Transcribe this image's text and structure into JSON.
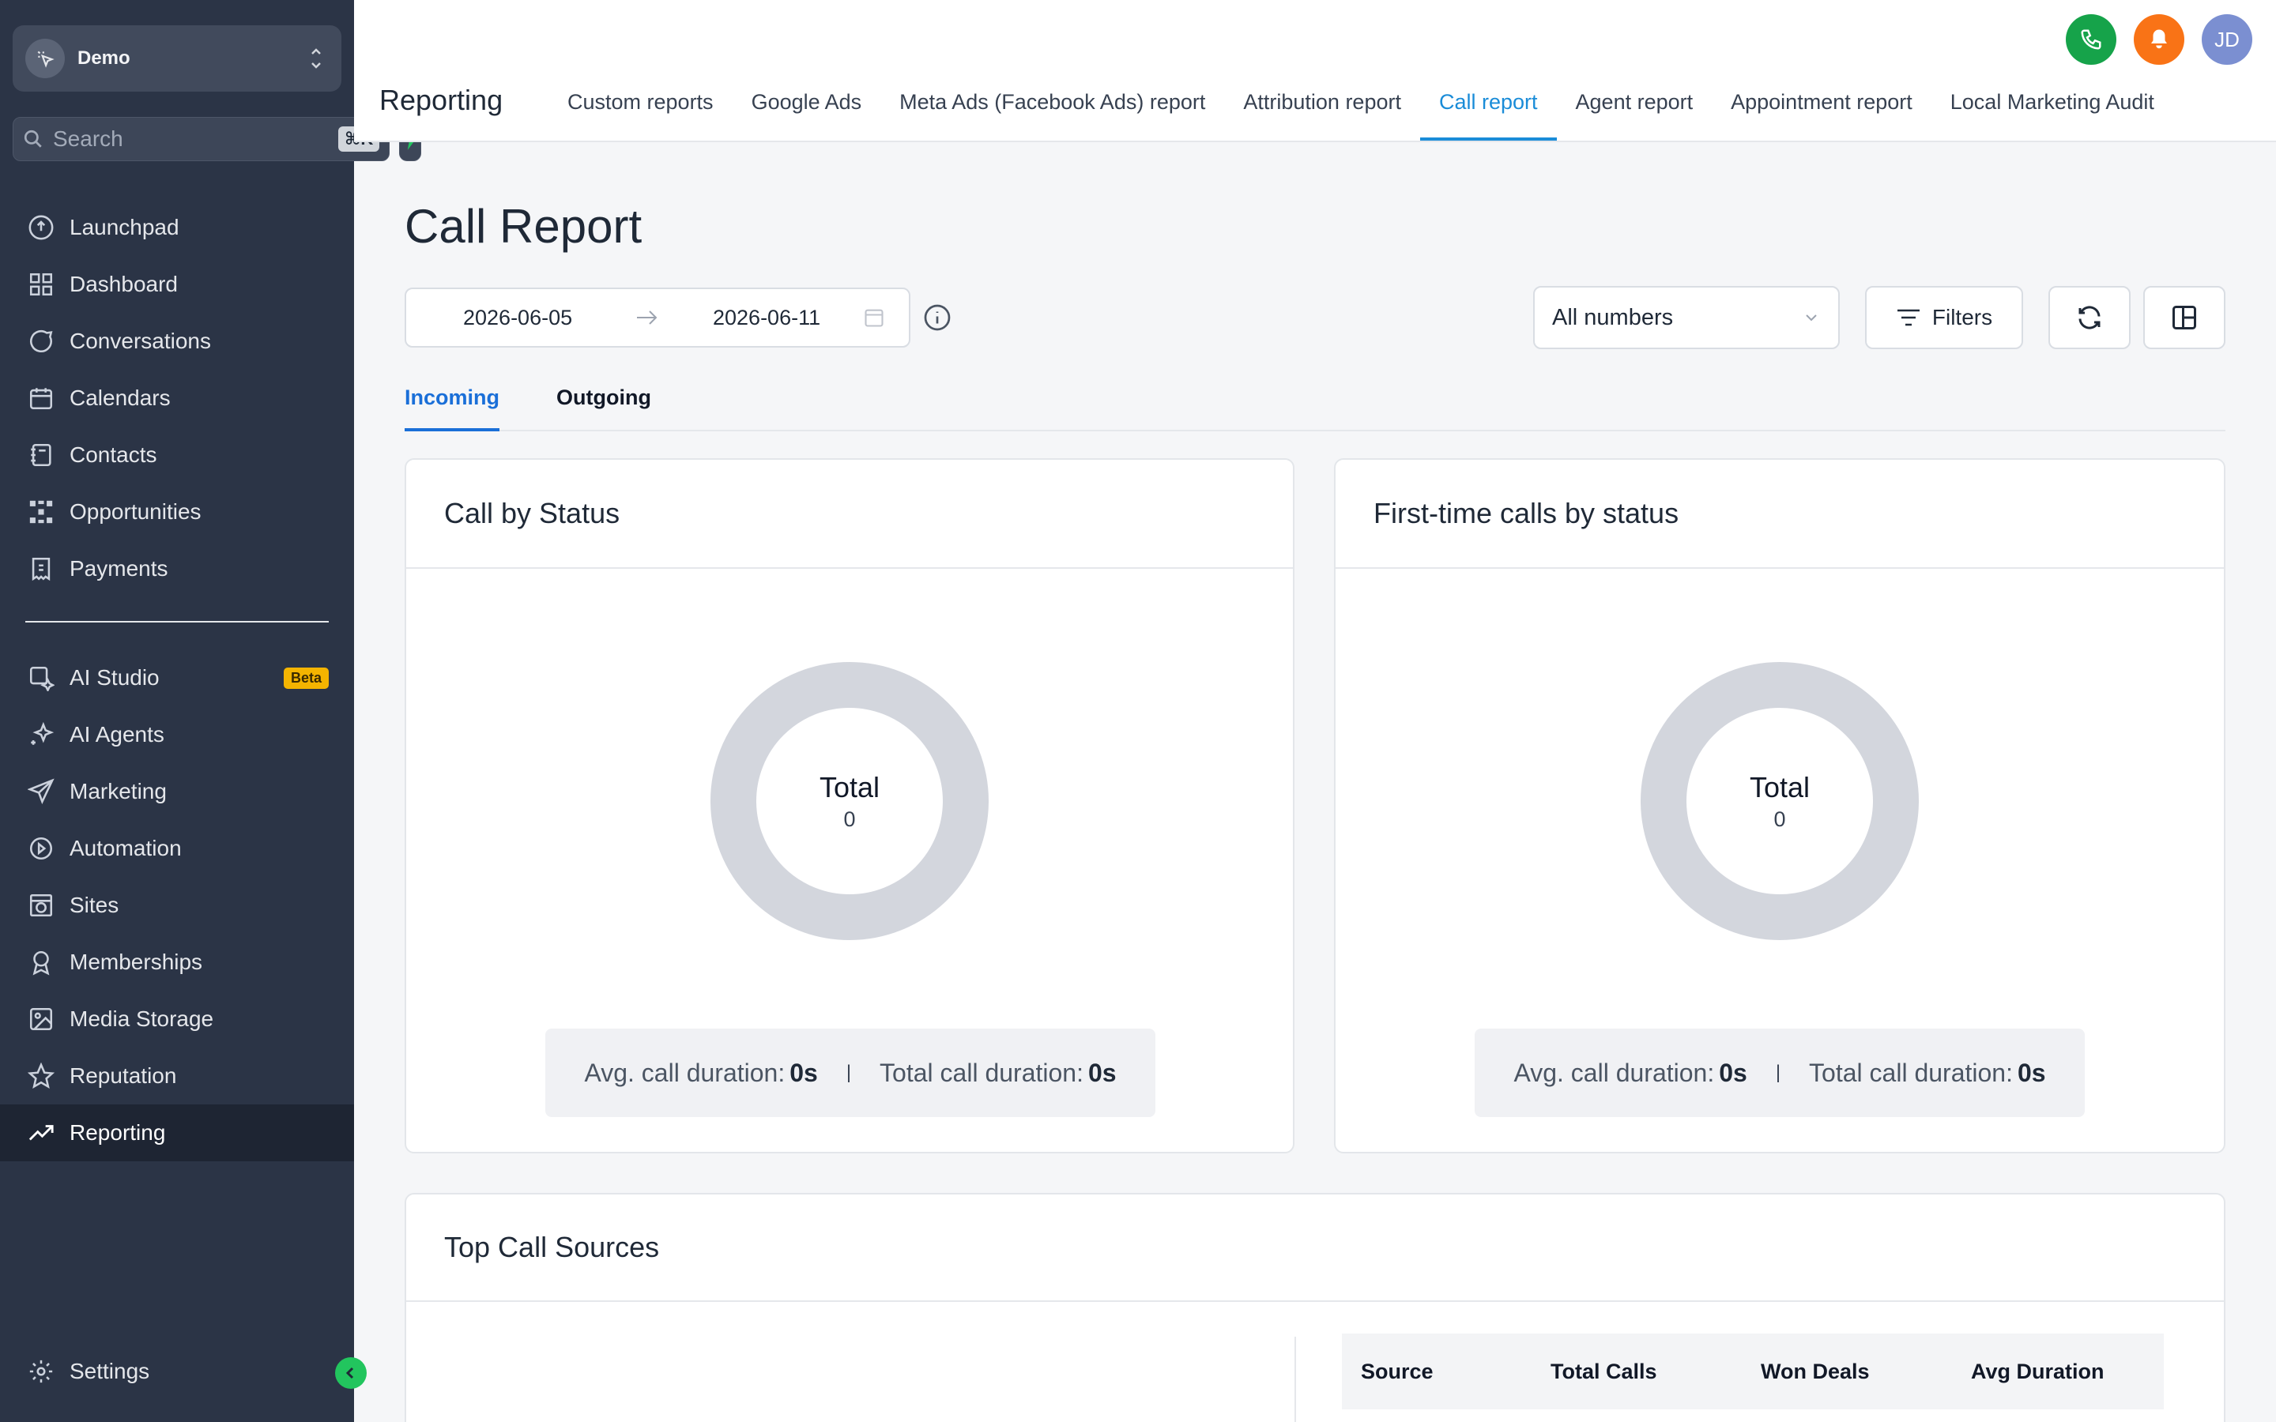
{
  "workspace": {
    "name": "Demo"
  },
  "search": {
    "placeholder": "Search",
    "shortcut": "⌘K"
  },
  "sidebar": {
    "items": [
      {
        "label": "Launchpad",
        "icon": "launchpad-icon"
      },
      {
        "label": "Dashboard",
        "icon": "dashboard-icon"
      },
      {
        "label": "Conversations",
        "icon": "chat-bubble-icon"
      },
      {
        "label": "Calendars",
        "icon": "calendar-icon"
      },
      {
        "label": "Contacts",
        "icon": "contact-book-icon"
      },
      {
        "label": "Opportunities",
        "icon": "opportunities-icon"
      },
      {
        "label": "Payments",
        "icon": "payments-icon"
      },
      {
        "label": "AI Studio",
        "icon": "ai-studio-icon",
        "badge": "Beta"
      },
      {
        "label": "AI Agents",
        "icon": "sparkle-icon"
      },
      {
        "label": "Marketing",
        "icon": "paper-plane-icon"
      },
      {
        "label": "Automation",
        "icon": "automation-icon"
      },
      {
        "label": "Sites",
        "icon": "globe-icon"
      },
      {
        "label": "Memberships",
        "icon": "award-icon"
      },
      {
        "label": "Media Storage",
        "icon": "image-icon"
      },
      {
        "label": "Reputation",
        "icon": "star-icon"
      },
      {
        "label": "Reporting",
        "icon": "trending-up-icon",
        "active": true
      }
    ],
    "settings": {
      "label": "Settings",
      "icon": "gear-icon"
    }
  },
  "header": {
    "title": "Reporting",
    "avatar_initials": "JD",
    "tabs": [
      {
        "label": "Custom reports"
      },
      {
        "label": "Google Ads"
      },
      {
        "label": "Meta Ads (Facebook Ads) report"
      },
      {
        "label": "Attribution report"
      },
      {
        "label": "Call report",
        "active": true
      },
      {
        "label": "Agent report"
      },
      {
        "label": "Appointment report"
      },
      {
        "label": "Local Marketing Audit"
      }
    ]
  },
  "page": {
    "title": "Call Report",
    "date_start": "2026-06-05",
    "date_end": "2026-06-11",
    "number_filter": "All numbers",
    "filters_label": "Filters",
    "subtabs": [
      {
        "label": "Incoming",
        "active": true
      },
      {
        "label": "Outgoing"
      }
    ]
  },
  "cards": {
    "by_status": {
      "title": "Call by Status",
      "total_label": "Total",
      "total_value": "0",
      "avg_label": "Avg. call duration:",
      "avg_value": "0s",
      "sep": "|",
      "total_dur_label": "Total call duration:",
      "total_dur_value": "0s"
    },
    "first_time": {
      "title": "First-time calls by status",
      "total_label": "Total",
      "total_value": "0",
      "avg_label": "Avg. call duration:",
      "avg_value": "0s",
      "sep": "|",
      "total_dur_label": "Total call duration:",
      "total_dur_value": "0s"
    },
    "top_sources": {
      "title": "Top Call Sources",
      "columns": [
        "Source",
        "Total Calls",
        "Won Deals",
        "Avg Duration"
      ]
    }
  },
  "colors": {
    "sidebar_bg": "#2b3446",
    "accent": "#1a8cd8",
    "phone": "#16a34a",
    "bell": "#f97316",
    "beta": "#f4b400",
    "donut": "#d3d6dd"
  }
}
